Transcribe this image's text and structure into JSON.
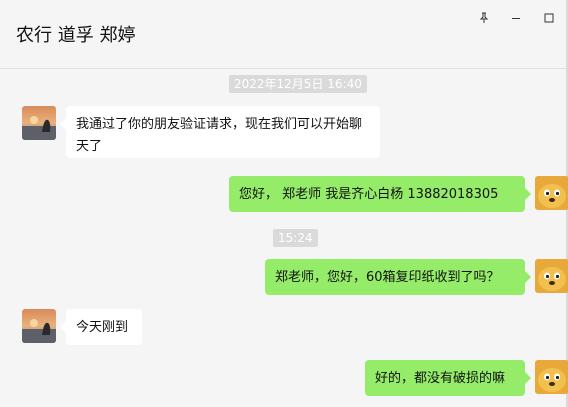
{
  "window": {
    "title": "农行 道孚  郑婷",
    "controls": [
      "pin-icon",
      "minimize-icon",
      "maximize-icon"
    ]
  },
  "colors": {
    "background": "#f5f5f5",
    "incoming_bubble": "#ffffff",
    "outgoing_bubble": "#95ec69",
    "timestamp_bg": "#dadada"
  },
  "chat": {
    "timestamps": [
      "2022年12月5日 16:40",
      "15:24"
    ],
    "messages": [
      {
        "side": "left",
        "avatar": "sunset-landscape-avatar",
        "text": "我通过了你的朋友验证请求，现在我们可以开始聊天了"
      },
      {
        "side": "right",
        "avatar": "cartoon-dog-avatar",
        "text": "您好，  郑老师 我是齐心白杨  13882018305"
      },
      {
        "side": "right",
        "avatar": "cartoon-dog-avatar",
        "text": "郑老师，您好，60箱复印纸收到了吗？"
      },
      {
        "side": "left",
        "avatar": "sunset-landscape-avatar",
        "text": "今天刚到"
      },
      {
        "side": "right",
        "avatar": "cartoon-dog-avatar",
        "text": "好的，都没有破损的嘛"
      }
    ]
  }
}
